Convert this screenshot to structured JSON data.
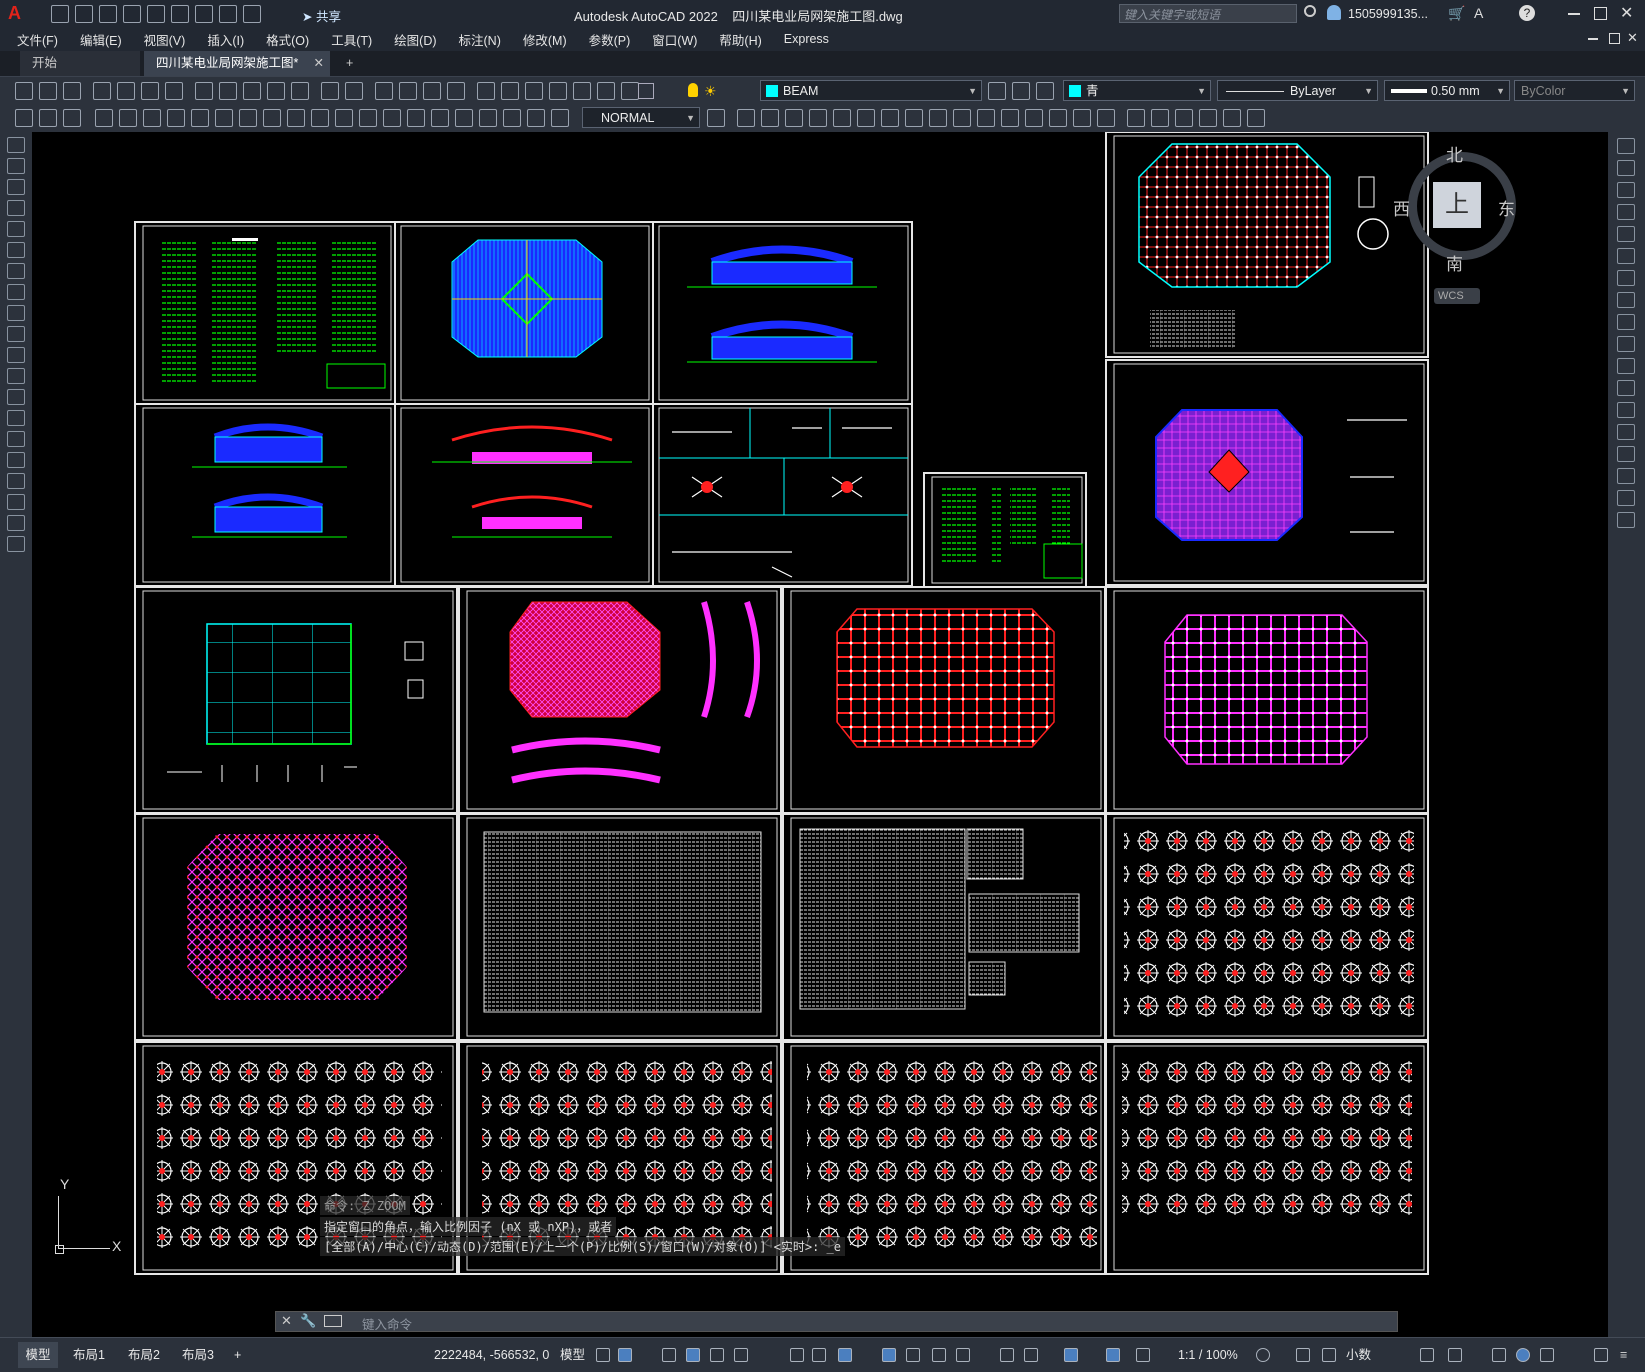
{
  "app": {
    "title": "Autodesk AutoCAD 2022    四川某电业局网架施工图.dwg",
    "search_placeholder": "键入关键字或短语",
    "user": "1505999135...",
    "share": "共享"
  },
  "menu": [
    "文件(F)",
    "编辑(E)",
    "视图(V)",
    "插入(I)",
    "格式(O)",
    "工具(T)",
    "绘图(D)",
    "标注(N)",
    "修改(M)",
    "参数(P)",
    "窗口(W)",
    "帮助(H)",
    "Express"
  ],
  "tabs": {
    "start": "开始",
    "doc": "四川某电业局网架施工图*",
    "add": "+"
  },
  "props": {
    "layer": "BEAM",
    "color": "青",
    "linetype": "ByLayer",
    "lineweight": "0.50 mm",
    "plotstyle": "ByColor",
    "dimstyle": "NORMAL"
  },
  "viewcube": {
    "north": "北",
    "south": "南",
    "east": "东",
    "west": "西",
    "top": "上",
    "wcs": "WCS"
  },
  "ucs": {
    "y": "Y",
    "x": "X"
  },
  "command": {
    "line1": "命令: Z ZOOM",
    "line2": "指定窗口的角点，输入比例因子 (nX 或 nXP)，或者",
    "line3": "[全部(A)/中心(C)/动态(D)/范围(E)/上一个(P)/比例(S)/窗口(W)/对象(O)] <实时>: _e",
    "placeholder": "键入命令"
  },
  "status": {
    "layout_tabs": [
      "模型",
      "布局1",
      "布局2",
      "布局3"
    ],
    "add": "+",
    "coords": "2222484, -566532, 0",
    "model": "模型",
    "scale": "1:1 / 100%",
    "units": "小数"
  },
  "colors": {
    "accent_cyan": "#00ffff",
    "grid_red": "#ff2020",
    "magenta": "#ff00ff",
    "green": "#00ff00",
    "blue": "#1a2aff"
  }
}
